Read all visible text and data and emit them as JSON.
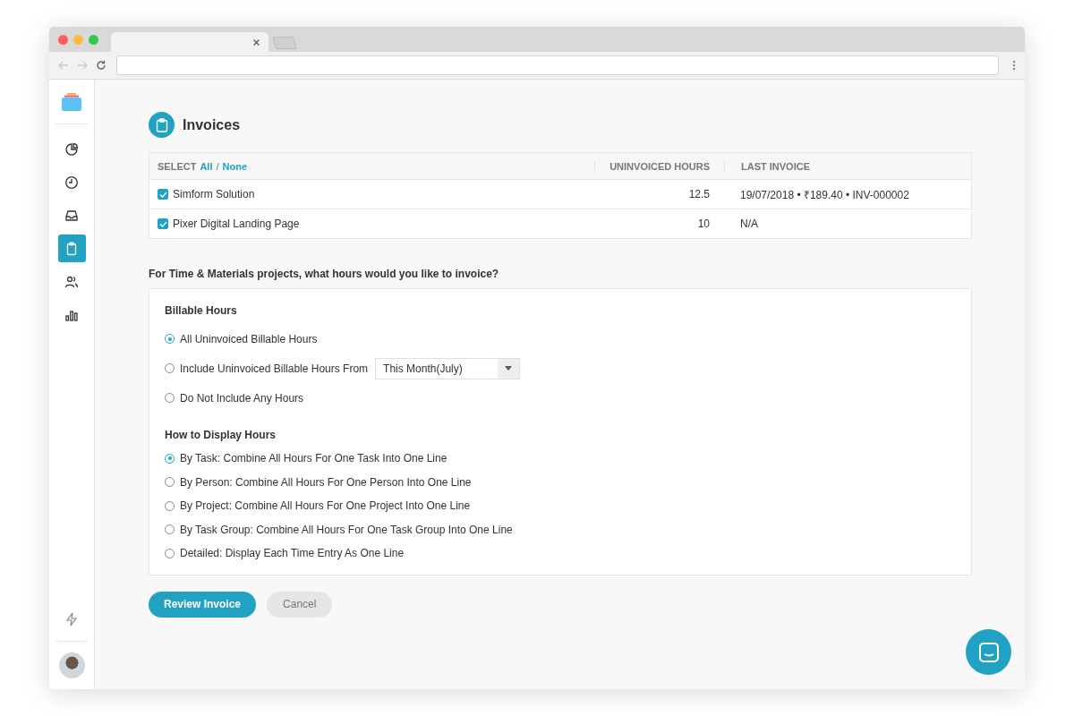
{
  "sidebar": {
    "items": [
      {
        "selected": false
      },
      {
        "selected": false
      },
      {
        "selected": false
      },
      {
        "selected": true
      },
      {
        "selected": false
      },
      {
        "selected": false
      }
    ]
  },
  "page": {
    "title": "Invoices"
  },
  "table": {
    "select_label": "SELECT",
    "all_link": "All",
    "separator": "/",
    "none_link": "None",
    "columns": [
      "UNINVOICED HOURS",
      "LAST INVOICE"
    ],
    "rows": [
      {
        "name": "Simform Solution",
        "checked": true,
        "hours": "12.5",
        "last_invoice": "19/07/2018 • ₹189.40 • INV-000002"
      },
      {
        "name": "Pixer Digital Landing Page",
        "checked": true,
        "hours": "10",
        "last_invoice": "N/A"
      }
    ]
  },
  "question": "For Time & Materials projects, what hours would you like to invoice?",
  "billable": {
    "heading": "Billable Hours",
    "options": [
      {
        "label": "All Uninvoiced Billable Hours",
        "selected": true,
        "kind": "plain"
      },
      {
        "label": "Include Uninvoiced Billable Hours From",
        "selected": false,
        "kind": "dropdown",
        "value": "This Month(July)"
      },
      {
        "label": "Do Not Include Any Hours",
        "selected": false,
        "kind": "plain"
      }
    ]
  },
  "display": {
    "heading": "How to Display Hours",
    "options": [
      {
        "label": "By Task: Combine All Hours For One Task Into One Line",
        "selected": true
      },
      {
        "label": "By Person: Combine All Hours For One Person Into One Line",
        "selected": false
      },
      {
        "label": "By Project: Combine All Hours For One Project Into One Line",
        "selected": false
      },
      {
        "label": "By Task Group: Combine All Hours For One Task Group Into One Line",
        "selected": false
      },
      {
        "label": "Detailed: Display Each Time Entry As One Line",
        "selected": false
      }
    ]
  },
  "buttons": {
    "primary": "Review Invoice",
    "secondary": "Cancel"
  }
}
